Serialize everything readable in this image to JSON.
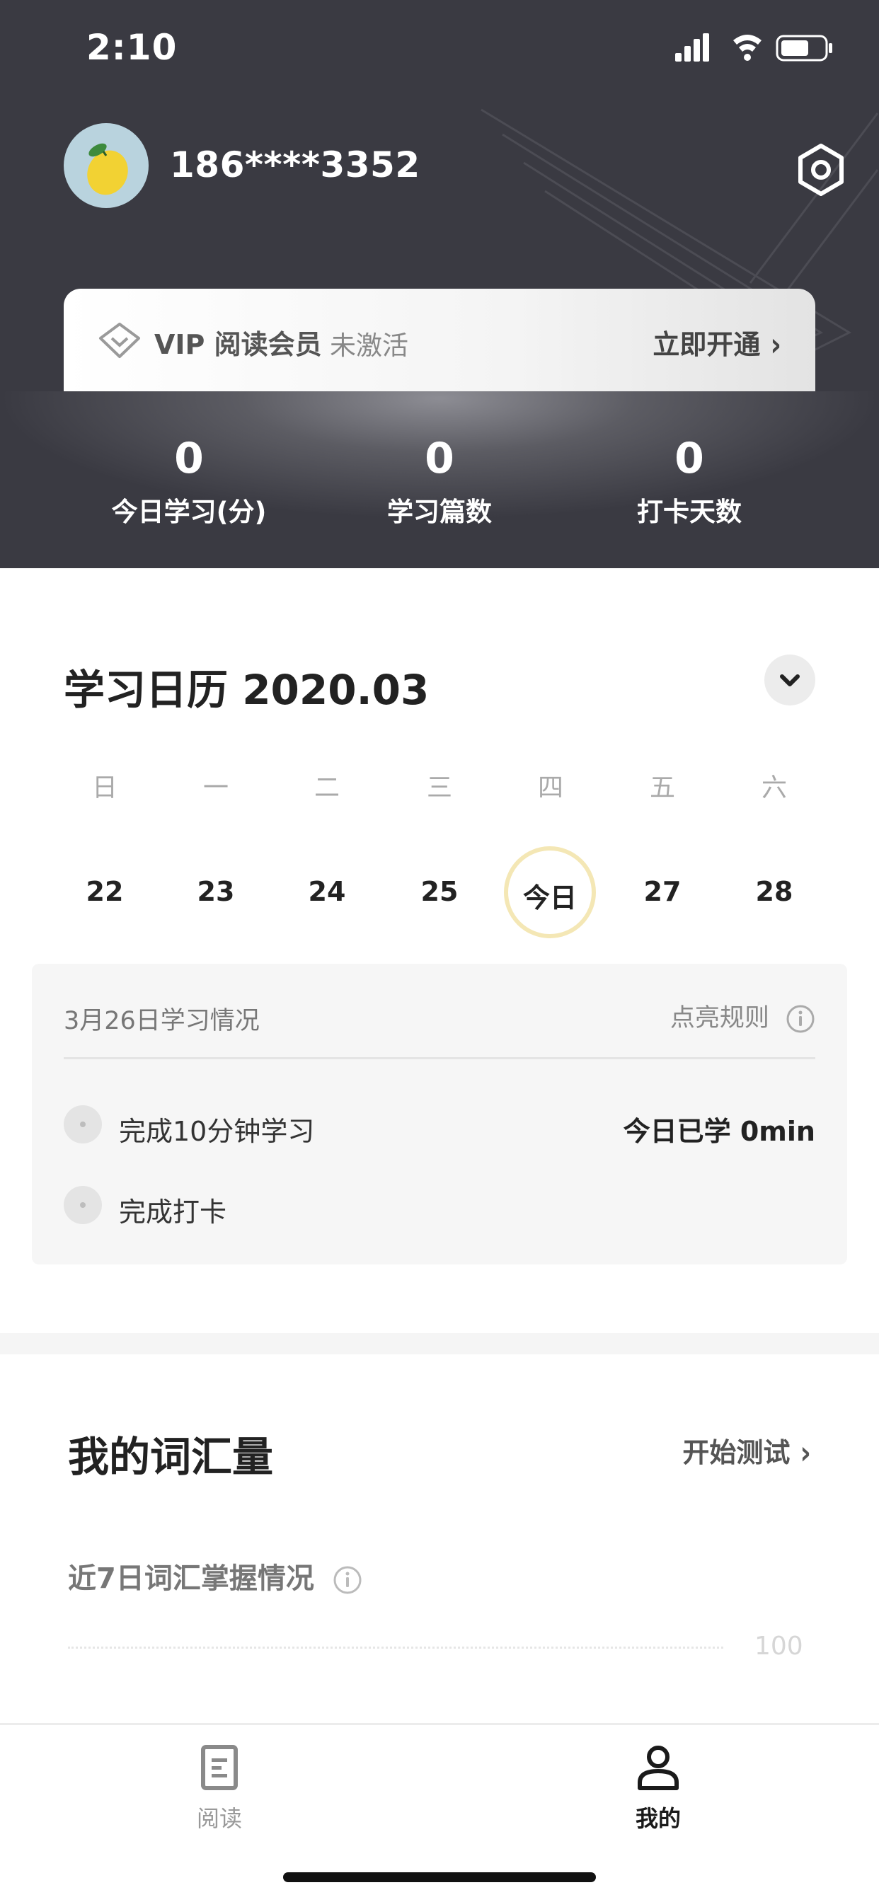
{
  "status": {
    "time": "2:10"
  },
  "profile": {
    "phone": "186****3352",
    "avatar_icon": "lemon-avatar-icon",
    "settings_icon": "gear-hexagon-icon"
  },
  "vip": {
    "title": "VIP 阅读会员",
    "status": "未激活",
    "cta": "立即开通",
    "cta_chevron": "›"
  },
  "stats": [
    {
      "value": "0",
      "label": "今日学习(分)"
    },
    {
      "value": "0",
      "label": "学习篇数"
    },
    {
      "value": "0",
      "label": "打卡天数"
    }
  ],
  "calendar": {
    "title": "学习日历 2020.03",
    "weekdays": [
      "日",
      "一",
      "二",
      "三",
      "四",
      "五",
      "六"
    ],
    "days": [
      "22",
      "23",
      "24",
      "25",
      "今日",
      "27",
      "28"
    ],
    "today_label": "今日",
    "highlight_color": "#f4e7b5"
  },
  "progress": {
    "date_label": "3月26日学习情况",
    "rules_label": "点亮规则",
    "tasks": [
      {
        "label": "完成10分钟学习",
        "value": "今日已学 0min"
      },
      {
        "label": "完成打卡",
        "value": ""
      }
    ]
  },
  "vocab": {
    "title": "我的词汇量",
    "cta": "开始测试",
    "cta_chevron": "›",
    "subtitle": "近7日词汇掌握情况",
    "axis_tick": "100"
  },
  "tabs": [
    {
      "label": "阅读",
      "icon": "document-icon",
      "active": false
    },
    {
      "label": "我的",
      "icon": "person-icon",
      "active": true
    }
  ]
}
